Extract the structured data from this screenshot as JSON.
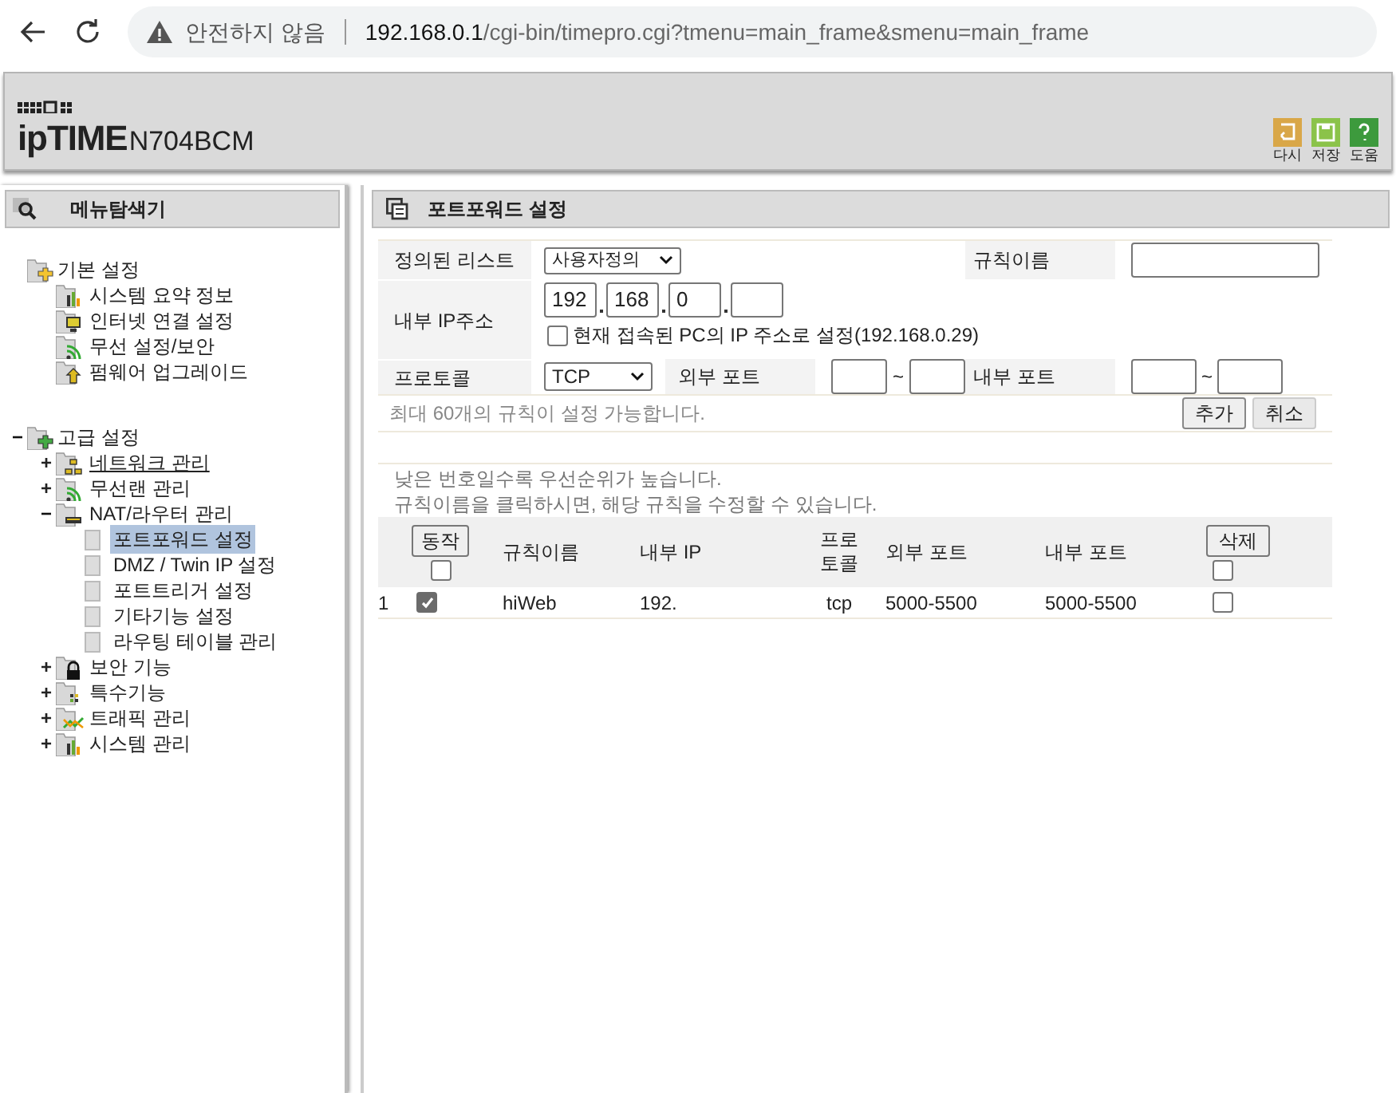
{
  "browser": {
    "warning": "안전하지 않음",
    "url_host": "192.168.0.1",
    "url_path": "/cgi-bin/timepro.cgi?tmenu=main_frame&smenu=main_frame"
  },
  "header": {
    "brand": "ipTIME",
    "model": "N704BCM",
    "actions": [
      {
        "label": "다시",
        "kind": "undo"
      },
      {
        "label": "저장",
        "kind": "save"
      },
      {
        "label": "도움",
        "kind": "help"
      }
    ]
  },
  "sidebar": {
    "title": "메뉴탐색기",
    "groups": [
      {
        "label": "기본 설정",
        "kind": "basic",
        "children": [
          {
            "label": "시스템 요약 정보",
            "kind": "chart"
          },
          {
            "label": "인터넷 연결 설정",
            "kind": "monitor"
          },
          {
            "label": "무선 설정/보안",
            "kind": "wifi"
          },
          {
            "label": "펌웨어 업그레이드",
            "kind": "upload"
          }
        ]
      },
      {
        "label": "고급 설정",
        "kind": "advanced",
        "toggle": "−",
        "expanded": true,
        "children": [
          {
            "label": "네트워크 관리",
            "kind": "network",
            "toggle": "+",
            "expanded": false,
            "underlined": true
          },
          {
            "label": "무선랜 관리",
            "kind": "wifi",
            "toggle": "+",
            "expanded": false,
            "underlined": false
          },
          {
            "label": "NAT/라우터 관리",
            "kind": "router",
            "toggle": "−",
            "expanded": true,
            "underlined": false,
            "children": [
              {
                "label": "포트포워드 설정",
                "selected": true
              },
              {
                "label": "DMZ / Twin IP 설정",
                "selected": false
              },
              {
                "label": "포트트리거 설정",
                "selected": false
              },
              {
                "label": "기타기능 설정",
                "selected": false
              },
              {
                "label": "라우팅 테이블 관리",
                "selected": false
              }
            ]
          },
          {
            "label": "보안 기능",
            "kind": "lock",
            "toggle": "+",
            "expanded": false,
            "underlined": false
          },
          {
            "label": "특수기능",
            "kind": "grid",
            "toggle": "+",
            "expanded": false,
            "underlined": false
          },
          {
            "label": "트래픽 관리",
            "kind": "traffic",
            "toggle": "+",
            "expanded": false,
            "underlined": false
          },
          {
            "label": "시스템 관리",
            "kind": "chart",
            "toggle": "+",
            "expanded": false,
            "underlined": false
          }
        ]
      }
    ]
  },
  "panel": {
    "title": "포트포워드 설정",
    "form": {
      "preset_label": "정의된 리스트",
      "preset_value": "사용자정의",
      "rule_name_label": "규칙이름",
      "ip_label": "내부 IP주소",
      "ip_parts": [
        "192",
        "168",
        "0"
      ],
      "use_current_label": "현재 접속된 PC의 IP 주소로 설정(192.168.0.29)",
      "use_current_checked": false,
      "protocol_label": "프로토콜",
      "protocol_value": "TCP",
      "ext_port_label": "외부 포트",
      "int_port_label": "내부 포트",
      "range_sep": "~",
      "limit_note": "최대 60개의 규칙이 설정 가능합니다.",
      "add_button": "추가",
      "cancel_button": "취소"
    },
    "notes": [
      "낮은 번호일수록 우선순위가 높습니다.",
      "규칙이름을 클릭하시면, 해당 규칙을 수정할 수 있습니다."
    ],
    "table": {
      "action_button": "동작",
      "action_all_checked": false,
      "columns": [
        "규칙이름",
        "내부 IP",
        "프로\n토콜",
        "외부 포트",
        "내부 포트"
      ],
      "delete_button": "삭제",
      "delete_all_checked": false,
      "rows": [
        {
          "index": "1",
          "active": true,
          "name": "hiWeb",
          "ip": "192.",
          "protocol": "tcp",
          "ext_port": "5000-5500",
          "int_port": "5000-5500",
          "delete_checked": false
        }
      ]
    }
  }
}
